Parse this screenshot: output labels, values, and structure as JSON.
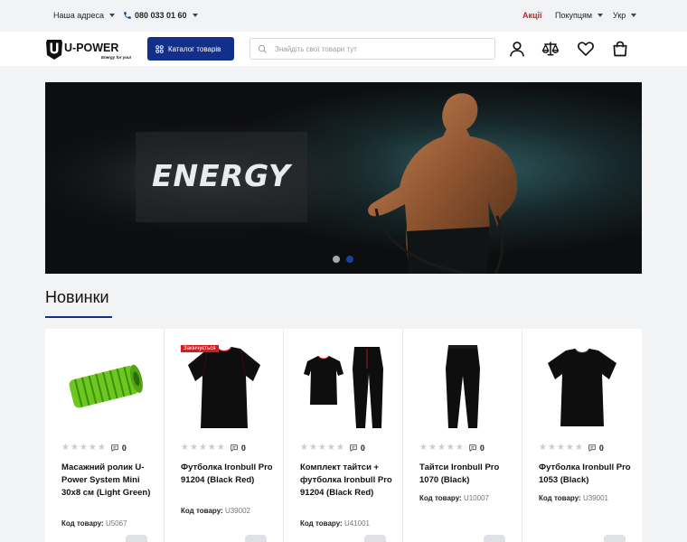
{
  "topbar": {
    "address": "Наша адреса",
    "phone": "080 033 01 60",
    "promo": "Акції",
    "buyers": "Покупцям",
    "language": "Укр"
  },
  "header": {
    "logo_text": "U-POWER",
    "logo_tagline": "Energy for you!",
    "catalog_label": "Каталог товарів",
    "search_placeholder": "Знайдіть свої товари тут",
    "icons": [
      "user-icon",
      "compare-icon",
      "heart-icon",
      "cart-icon"
    ]
  },
  "hero": {
    "title": "ENERGY",
    "slides": 2,
    "active_slide": 2
  },
  "section": {
    "title": "Новинки"
  },
  "products": [
    {
      "name": "Масажний ролик U-Power System Mini 30x8 см (Light Green)",
      "code_label": "Код товару:",
      "code": "U5067",
      "reviews": "0",
      "badge": ""
    },
    {
      "name": "Футболка Ironbull Pro 91204 (Black Red)",
      "code_label": "Код товару:",
      "code": "U39002",
      "reviews": "0",
      "badge": "Закінчується"
    },
    {
      "name": "Комплект тайтси + футболка Ironbull Pro 91204 (Black Red)",
      "code_label": "Код товару:",
      "code": "U41001",
      "reviews": "0",
      "badge": ""
    },
    {
      "name": "Тайтси Ironbull Pro 1070 (Black)",
      "code_label": "Код товару:",
      "code": "U10007",
      "reviews": "0",
      "badge": ""
    },
    {
      "name": "Футболка Ironbull Pro 1053 (Black)",
      "code_label": "Код товару:",
      "code": "U39001",
      "reviews": "0",
      "badge": ""
    }
  ],
  "colors": {
    "accent": "#12308a",
    "promo_red": "#d21d1d",
    "roller_green": "#6cc81e"
  }
}
